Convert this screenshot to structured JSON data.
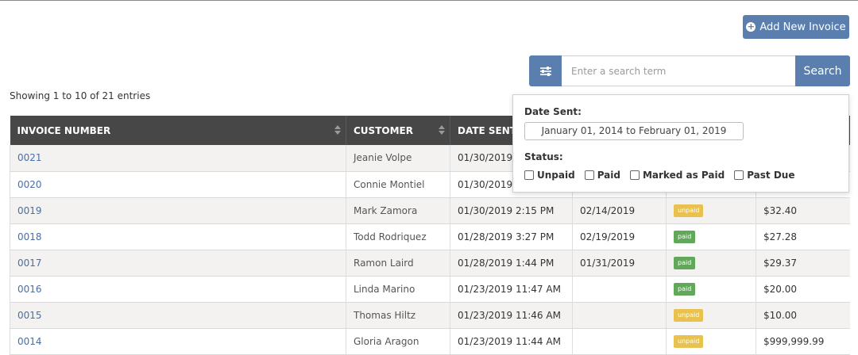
{
  "toolbar": {
    "add_label": "Add New Invoice",
    "search_placeholder": "Enter a search term",
    "search_label": "Search"
  },
  "table_info": "Showing 1 to 10 of 21 entries",
  "columns": [
    "INVOICE NUMBER",
    "CUSTOMER",
    "DATE SENT"
  ],
  "rows": [
    {
      "number": "0021",
      "customer": "Jeanie Volpe",
      "date_sent": "01/30/2019",
      "due": "",
      "status": "",
      "amount": ""
    },
    {
      "number": "0020",
      "customer": "Connie Montiel",
      "date_sent": "01/30/2019",
      "due": "",
      "status": "",
      "amount": ""
    },
    {
      "number": "0019",
      "customer": "Mark Zamora",
      "date_sent": "01/30/2019 2:15 PM",
      "due": "02/14/2019",
      "status": "unpaid",
      "amount": "$32.40"
    },
    {
      "number": "0018",
      "customer": "Todd Rodriquez",
      "date_sent": "01/28/2019 3:27 PM",
      "due": "02/19/2019",
      "status": "paid",
      "amount": "$27.28"
    },
    {
      "number": "0017",
      "customer": "Ramon Laird",
      "date_sent": "01/28/2019 1:44 PM",
      "due": "01/31/2019",
      "status": "paid",
      "amount": "$29.37"
    },
    {
      "number": "0016",
      "customer": "Linda Marino",
      "date_sent": "01/23/2019 11:47 AM",
      "due": "",
      "status": "paid",
      "amount": "$20.00"
    },
    {
      "number": "0015",
      "customer": "Thomas Hiltz",
      "date_sent": "01/23/2019 11:46 AM",
      "due": "",
      "status": "unpaid",
      "amount": "$10.00"
    },
    {
      "number": "0014",
      "customer": "Gloria Aragon",
      "date_sent": "01/23/2019 11:44 AM",
      "due": "",
      "status": "unpaid",
      "amount": "$999,999.99"
    }
  ],
  "filter": {
    "date_label": "Date Sent:",
    "date_range": "January 01, 2014 to February 01, 2019",
    "status_label": "Status:",
    "options": [
      "Unpaid",
      "Paid",
      "Marked as Paid",
      "Past Due"
    ]
  },
  "colors": {
    "accent": "#5a7fae",
    "header_bg": "#474747",
    "unpaid": "#e8c14e",
    "paid": "#62a85a",
    "link": "#4a6ea5"
  }
}
